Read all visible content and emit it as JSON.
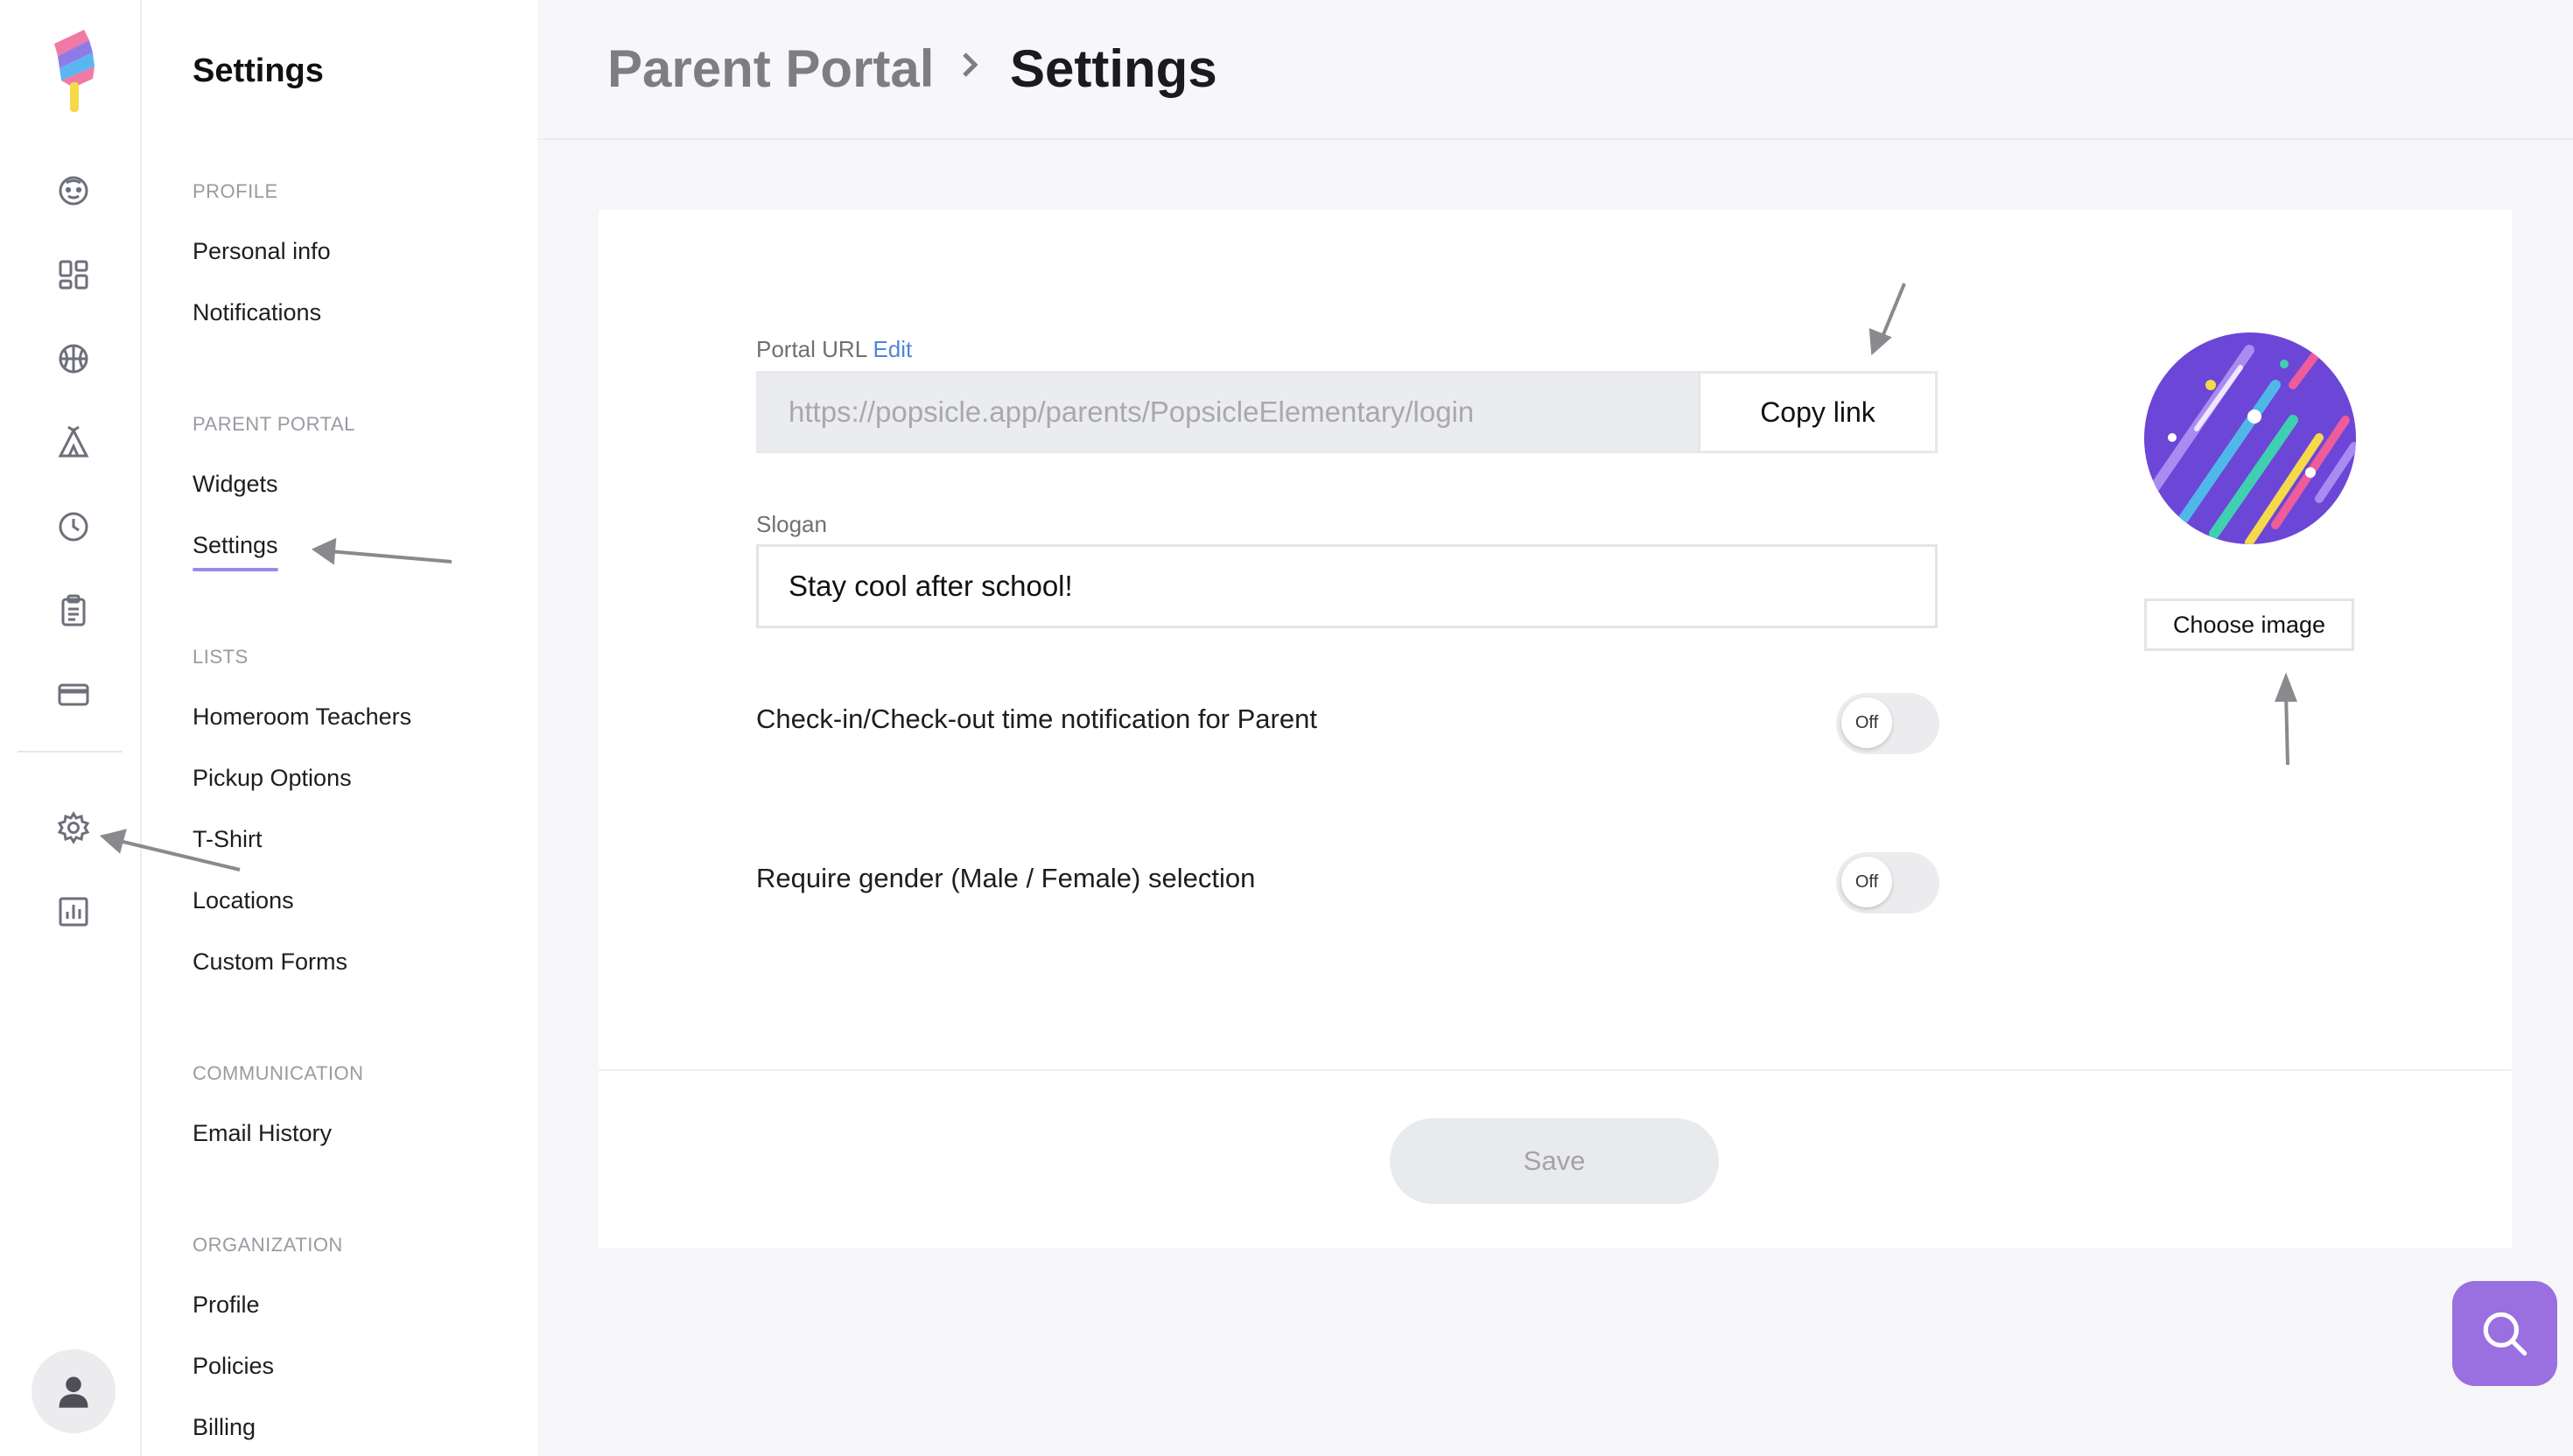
{
  "brand": {
    "colors": {
      "accent": "#9b8ae8",
      "link": "#4f87d6",
      "help": "#9a6fe0"
    }
  },
  "rail": {
    "icons": [
      "face-icon",
      "dashboard-icon",
      "basketball-icon",
      "camp-tent-icon",
      "clock-icon",
      "clipboard-icon",
      "credit-card-icon",
      "gear-icon",
      "bar-chart-icon"
    ],
    "avatar_icon": "user-icon"
  },
  "sidebar": {
    "title": "Settings",
    "sections": [
      {
        "label": "PROFILE",
        "items": [
          "Personal info",
          "Notifications"
        ]
      },
      {
        "label": "PARENT PORTAL",
        "items": [
          "Widgets",
          "Settings"
        ],
        "active": "Settings"
      },
      {
        "label": "LISTS",
        "items": [
          "Homeroom Teachers",
          "Pickup Options",
          "T-Shirt",
          "Locations",
          "Custom Forms"
        ]
      },
      {
        "label": "COMMUNICATION",
        "items": [
          "Email History"
        ]
      },
      {
        "label": "ORGANIZATION",
        "items": [
          "Profile",
          "Policies",
          "Billing"
        ]
      }
    ]
  },
  "header": {
    "breadcrumb_parent": "Parent Portal",
    "breadcrumb_current": "Settings"
  },
  "form": {
    "portal_url_label": "Portal URL",
    "edit_label": "Edit",
    "portal_url_value": "https://popsicle.app/parents/PopsicleElementary/login",
    "copy_link_label": "Copy link",
    "slogan_label": "Slogan",
    "slogan_value": "Stay cool after school!",
    "toggles": [
      {
        "label": "Check-in/Check-out time notification for Parent",
        "state": "Off"
      },
      {
        "label": "Require gender (Male / Female) selection",
        "state": "Off"
      }
    ],
    "choose_image_label": "Choose image",
    "save_label": "Save"
  }
}
